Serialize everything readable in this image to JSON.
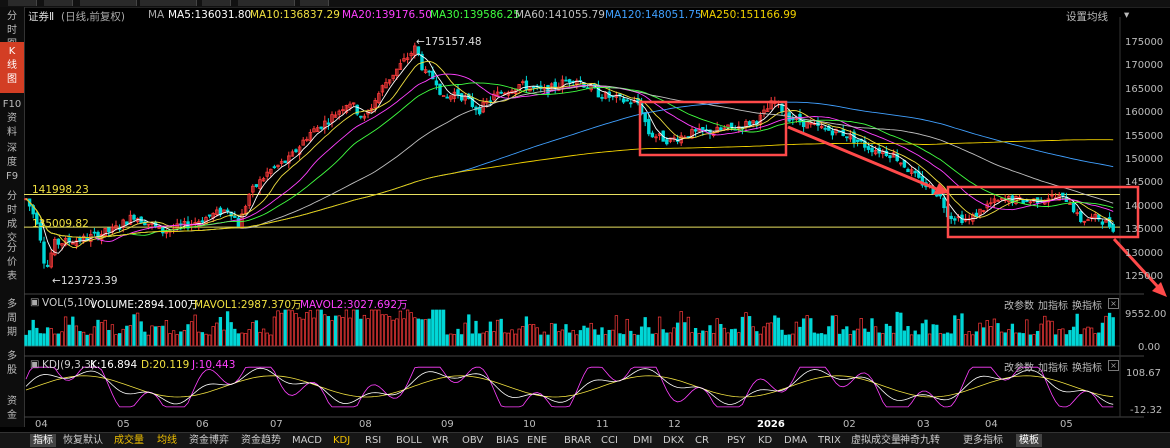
{
  "sidebar": [
    {
      "label": "分\n时\n图",
      "active": false
    },
    {
      "label": "K\n线\n图",
      "active": true
    },
    {
      "label": "F10\n资\n料",
      "active": false
    },
    {
      "label": "深\n度\nF9",
      "active": false
    },
    {
      "label": "分\n时\n成\n交",
      "active": false
    },
    {
      "label": "分\n价\n表",
      "active": false
    },
    {
      "label": "多\n周\n期",
      "active": false
    },
    {
      "label": "多\n股",
      "active": false
    },
    {
      "label": "资\n金",
      "active": false
    }
  ],
  "main_header": {
    "symbol": "证券Ⅱ",
    "mode": "(日线,前复权)",
    "ma_label": "MA",
    "ma5": "MA5:136031.80",
    "ma10": "MA10:136837.29",
    "ma20": "MA20:139176.50",
    "ma30": "MA30:139586.25",
    "ma60": "MA60:141055.79",
    "ma120": "MA120:148051.75",
    "ma250": "MA250:151166.99",
    "settings": "设置均线"
  },
  "price_axis": [
    "175000",
    "170000",
    "165000",
    "160000",
    "155000",
    "150000",
    "145000",
    "140000",
    "135000",
    "130000",
    "125000"
  ],
  "price_annotations": {
    "high": "175157.48",
    "low": "123723.39",
    "line1": "141998.23",
    "line2": "135009.82"
  },
  "vol_header": {
    "title": "VOL(5,10)",
    "volume": "VOLUME:2894.100万",
    "mavol1": "MAVOL1:2987.370万",
    "mavol2": "MAVOL2:3027.692万",
    "axis_top": "9552.00",
    "axis_bottom": "0.00"
  },
  "kdj_header": {
    "title": "KDJ(9,3,3)",
    "k": "K:16.894",
    "d": "D:20.119",
    "j": "J:10.443",
    "axis_top": "108.67",
    "axis_bottom": "-12.32"
  },
  "panel_buttons": {
    "params": "改参数",
    "add": "加指标",
    "swap": "换指标",
    "close": "×"
  },
  "x_axis": [
    "04",
    "05",
    "06",
    "07",
    "08",
    "09",
    "10",
    "11",
    "12",
    "2026",
    "02",
    "03",
    "04",
    "05"
  ],
  "bottom_tabs": [
    {
      "label": "指标",
      "active": false,
      "mode": true
    },
    {
      "label": "恢复默认",
      "active": false
    },
    {
      "label": "成交量",
      "active": true
    },
    {
      "label": "均线",
      "active": true
    },
    {
      "label": "资金博弈",
      "active": false
    },
    {
      "label": "资金趋势",
      "active": false
    },
    {
      "label": "MACD",
      "active": false
    },
    {
      "label": "KDJ",
      "active": true
    },
    {
      "label": "RSI",
      "active": false
    },
    {
      "label": "BOLL",
      "active": false
    },
    {
      "label": "WR",
      "active": false
    },
    {
      "label": "OBV",
      "active": false
    },
    {
      "label": "BIAS",
      "active": false
    },
    {
      "label": "ENE",
      "active": false
    },
    {
      "label": "BRAR",
      "active": false
    },
    {
      "label": "CCI",
      "active": false
    },
    {
      "label": "DMI",
      "active": false
    },
    {
      "label": "DKX",
      "active": false
    },
    {
      "label": "CR",
      "active": false
    },
    {
      "label": "PSY",
      "active": false
    },
    {
      "label": "KD",
      "active": false
    },
    {
      "label": "DMA",
      "active": false
    },
    {
      "label": "TRIX",
      "active": false
    },
    {
      "label": "虚拟成交量",
      "active": false
    },
    {
      "label": "神奇九转",
      "active": false
    },
    {
      "label": "更多指标",
      "active": false
    },
    {
      "label": "模板",
      "active": false,
      "mode": true
    }
  ],
  "colors": {
    "up": "#ff3b3b",
    "down": "#00d7d7",
    "ma5": "#ffffff",
    "ma10": "#f0e040",
    "ma20": "#ff40ff",
    "ma30": "#40ff40",
    "ma60": "#c0c0c0",
    "ma120": "#40a0ff",
    "ma250": "#f0d000",
    "highlight": "#ff4a4a"
  }
}
